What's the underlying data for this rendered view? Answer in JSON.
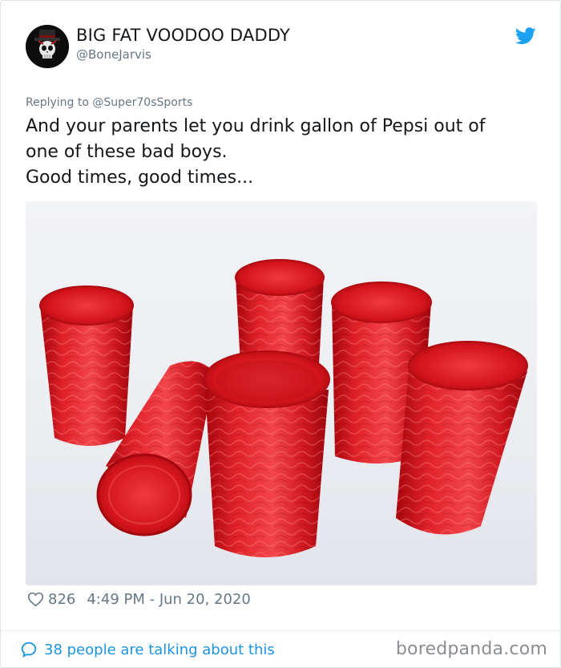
{
  "tweet": {
    "author_name": "BIG FAT VOODOO DADDY",
    "author_handle": "@BoneJarvis",
    "replying_to": "Replying to @Super70sSports",
    "text_lines": [
      "And your parents let you drink gallon of Pepsi out of",
      "one of these bad boys.",
      "Good times, good times..."
    ],
    "likes": "826",
    "timestamp": "4:49 PM - Jun 20, 2020",
    "conversation_link": "38 people are talking about this"
  },
  "watermark": "boredpanda.com",
  "icons": {
    "brand": "twitter-bird-icon",
    "like": "heart-icon",
    "conversation": "speech-bubble-icon"
  },
  "colors": {
    "link_blue": "#1b95e0",
    "muted_gray": "#657786",
    "twitter_blue": "#1da1f2",
    "tumbler_red": "#d4141c"
  }
}
